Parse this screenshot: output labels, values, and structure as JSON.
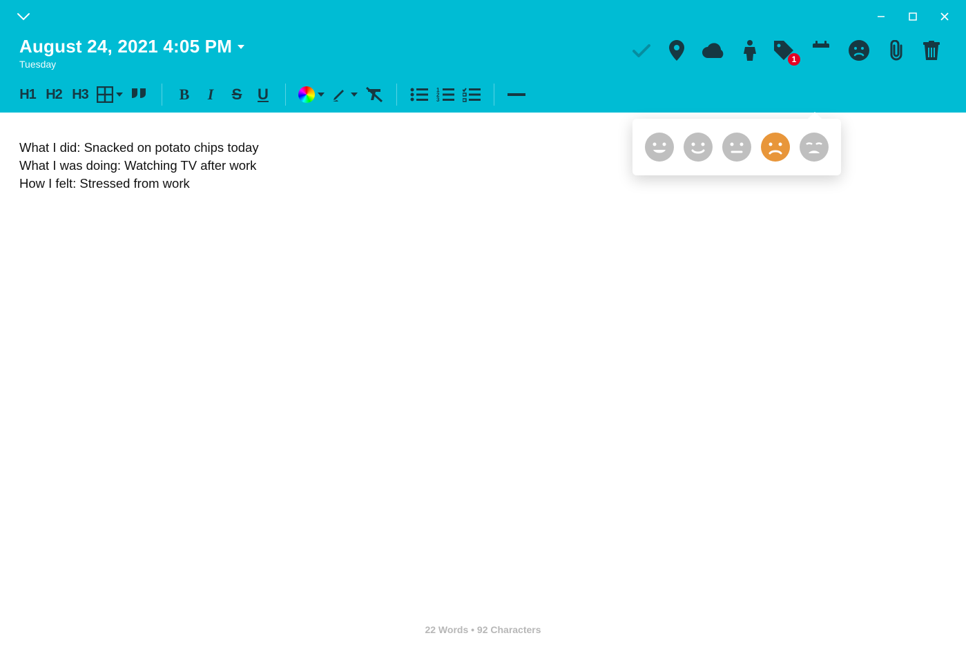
{
  "header": {
    "date": "August 24, 2021 4:05 PM",
    "day": "Tuesday",
    "tag_badge": "1"
  },
  "toolbar": {
    "h1": "H1",
    "h2": "H2",
    "h3": "H3"
  },
  "entry": {
    "line1": "What I did: Snacked on potato chips today",
    "line2": "What I was doing: Watching TV after work",
    "line3": "How I felt: Stressed from work"
  },
  "mood": {
    "selected_index": 3
  },
  "status": {
    "text": "22 Words • 92 Characters"
  }
}
